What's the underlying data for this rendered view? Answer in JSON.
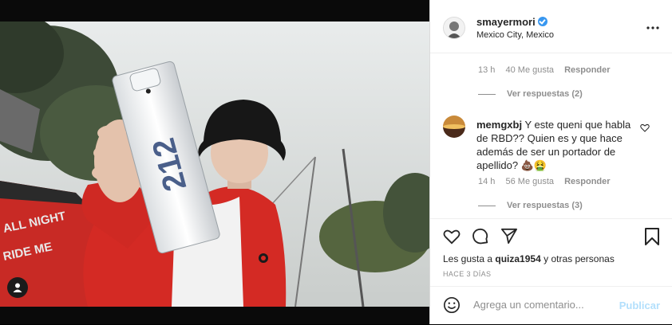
{
  "post": {
    "username": "smayermori",
    "location": "Mexico City, Mexico",
    "more_icon": "more-horizontal-icon",
    "bottle_label": "212"
  },
  "thread": {
    "first_meta": {
      "time": "13 h",
      "likes": "40 Me gusta",
      "reply": "Responder"
    },
    "first_replies": "Ver respuestas (2)",
    "comment": {
      "username": "memgxbj",
      "text": "Y este queni que habla de RBD?? Quien es y que hace además de ser un portador de apellido? 💩🤮",
      "time": "14 h",
      "likes": "56 Me gusta",
      "reply": "Responder",
      "replies": "Ver respuestas (3)"
    }
  },
  "actions": {
    "likes_prefix": "Les gusta a",
    "likes_user": "quiza1954",
    "likes_suffix": "y otras personas",
    "date": "HACE 3 DÍAS"
  },
  "comment_box": {
    "placeholder": "Agrega un comentario...",
    "publish": "Publicar"
  },
  "colors": {
    "verified": "#3897f0",
    "publish_disabled": "#b2dffc",
    "jacket": "#d42a24"
  }
}
